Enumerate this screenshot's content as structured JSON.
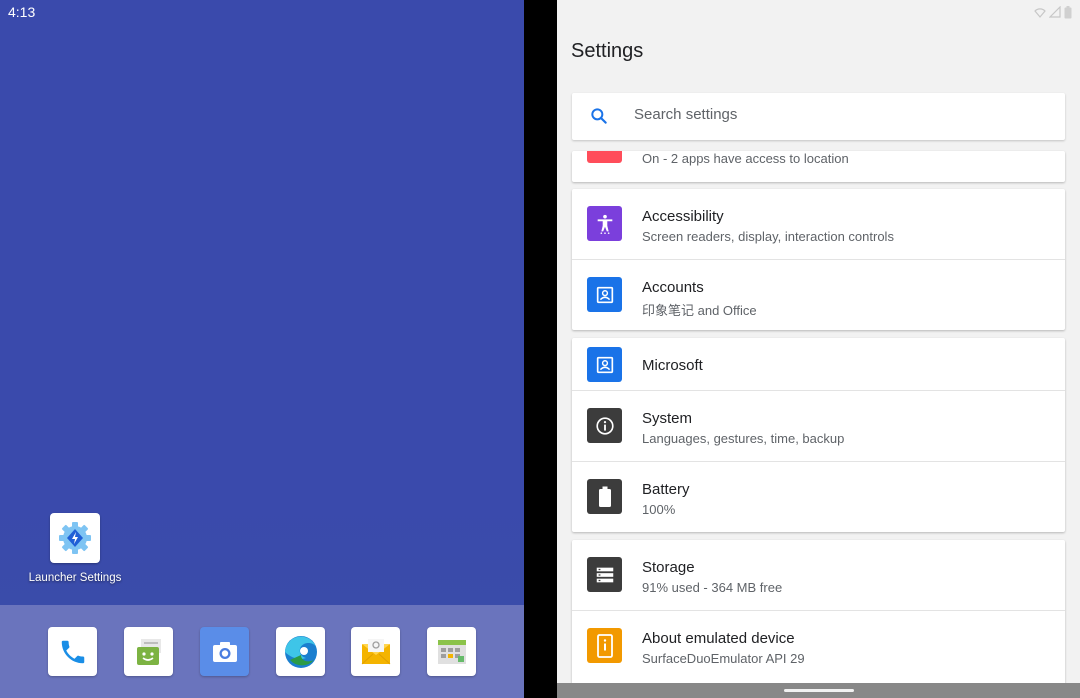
{
  "left_screen": {
    "status_time": "4:13",
    "home_app": {
      "label": "Launcher Settings",
      "icon": "launcher-settings-gear-icon"
    },
    "dock": [
      {
        "icon": "phone-icon"
      },
      {
        "icon": "messages-icon"
      },
      {
        "icon": "camera-icon"
      },
      {
        "icon": "edge-browser-icon"
      },
      {
        "icon": "email-icon"
      },
      {
        "icon": "calendar-icon"
      }
    ]
  },
  "right_screen": {
    "title": "Settings",
    "search": {
      "placeholder": "Search settings"
    },
    "location_partial": {
      "subtitle": "On - 2 apps have access to location"
    },
    "items": {
      "accessibility": {
        "title": "Accessibility",
        "subtitle": "Screen readers, display, interaction controls"
      },
      "accounts": {
        "title": "Accounts",
        "subtitle": "印象笔记 and Office"
      },
      "microsoft": {
        "title": "Microsoft"
      },
      "system": {
        "title": "System",
        "subtitle": "Languages, gestures, time, backup"
      },
      "battery": {
        "title": "Battery",
        "subtitle": "100%"
      },
      "storage": {
        "title": "Storage",
        "subtitle": "91% used - 364 MB free"
      },
      "about": {
        "title": "About emulated device",
        "subtitle": "SurfaceDuoEmulator API 29"
      }
    }
  },
  "colors": {
    "wallpaper": "#3a4aac",
    "dock": "#6a74bd",
    "accessibility_icon": "#7b3fdc",
    "account_icon": "#1a73e8",
    "system_icon": "#3c3c3c",
    "about_icon": "#f29900",
    "location_icon": "#ff4d5a"
  }
}
